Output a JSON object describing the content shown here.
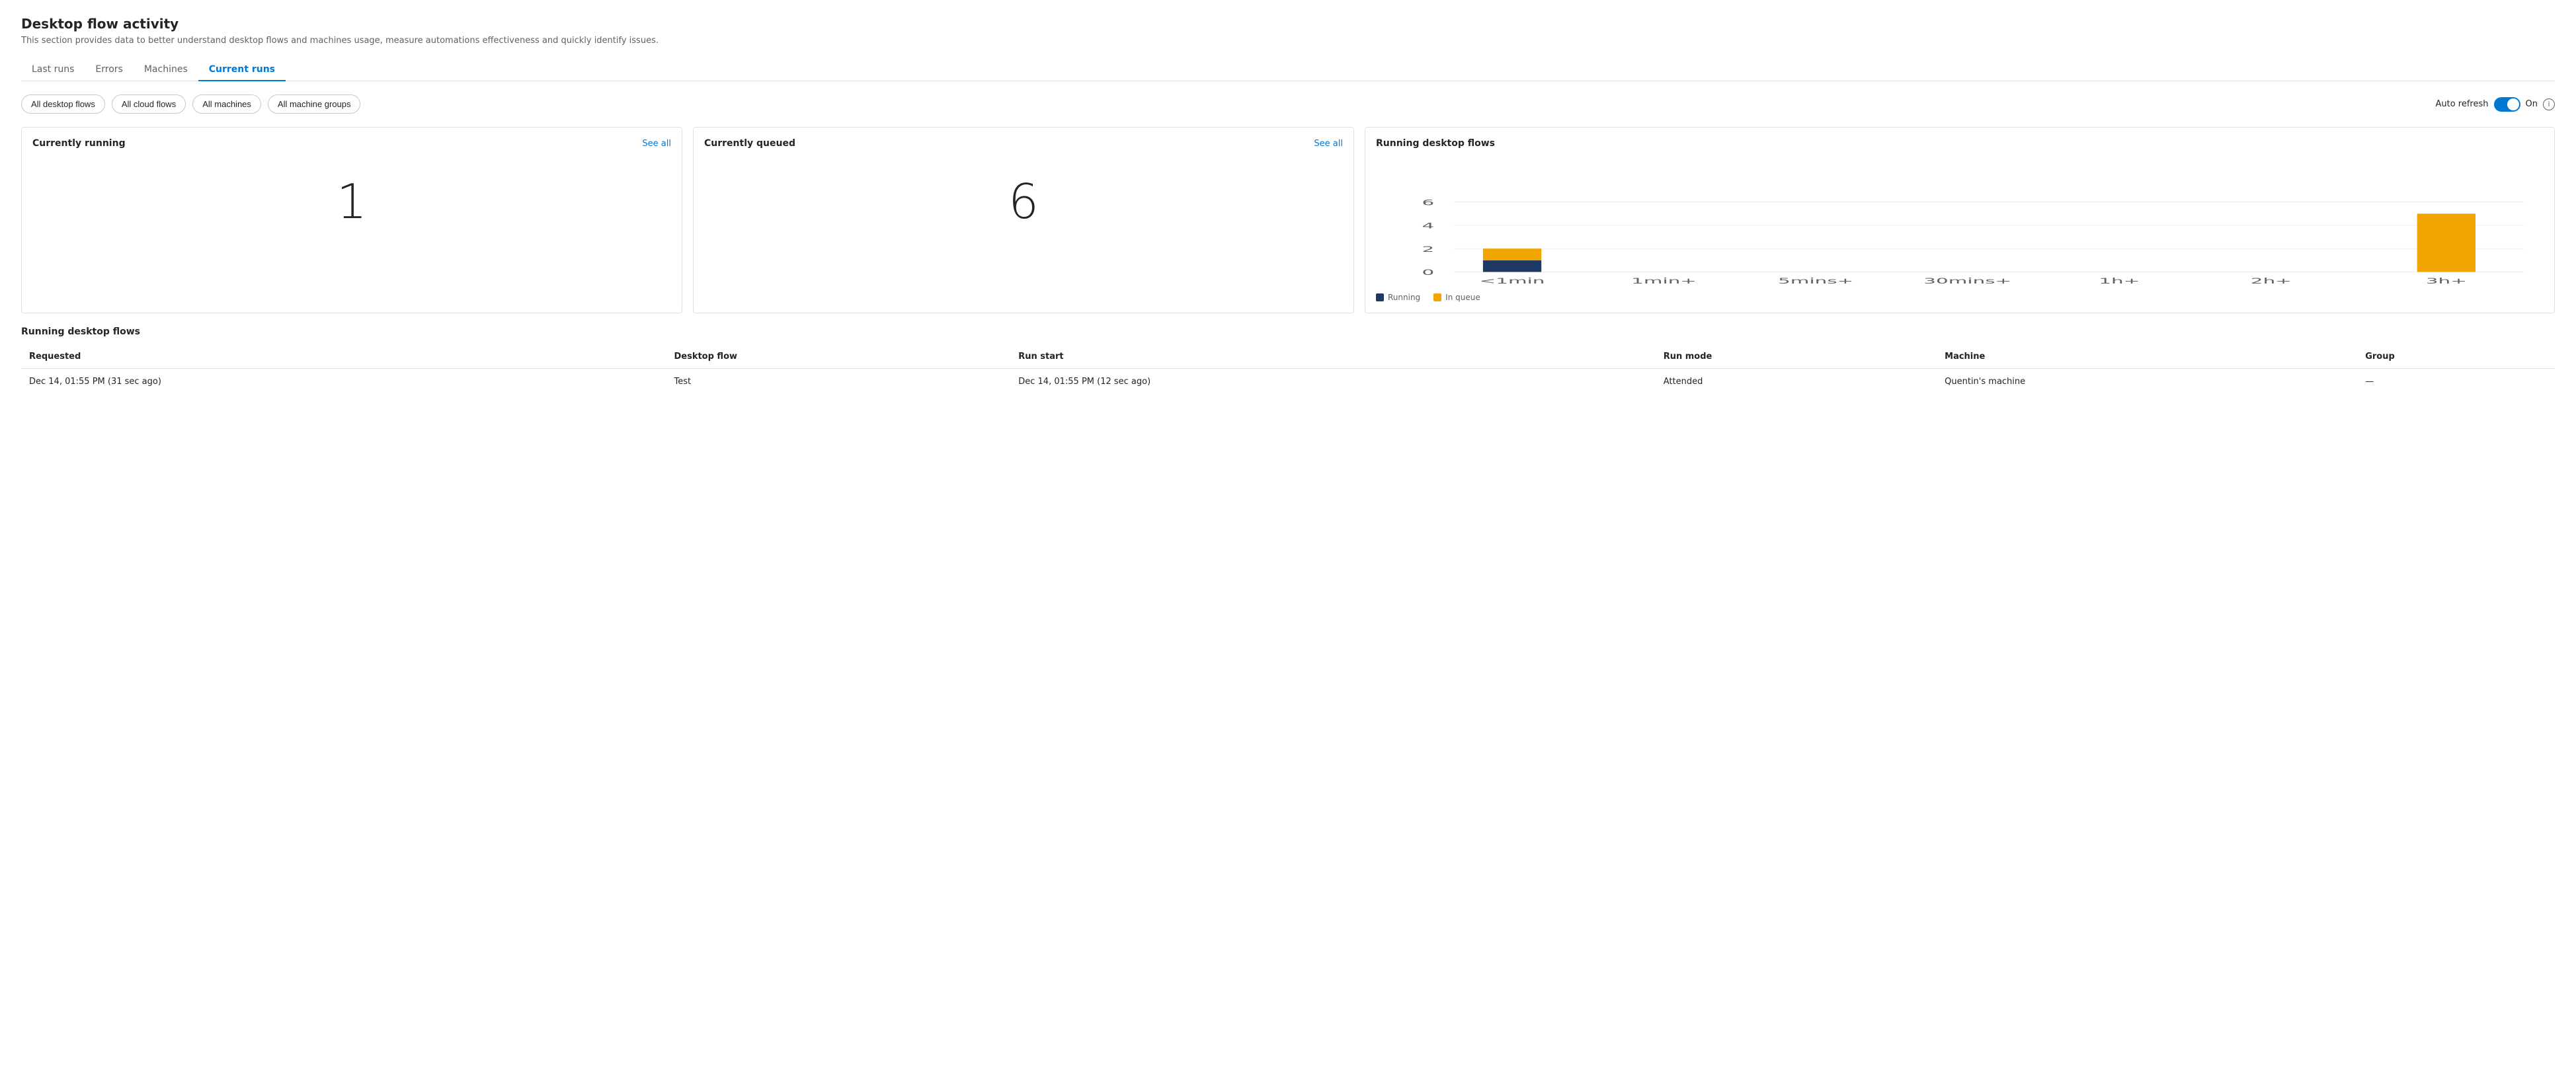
{
  "page": {
    "title": "Desktop flow activity",
    "subtitle": "This section provides data to better understand desktop flows and machines usage, measure automations effectiveness and quickly identify issues."
  },
  "tabs": [
    {
      "id": "last-runs",
      "label": "Last runs",
      "active": false
    },
    {
      "id": "errors",
      "label": "Errors",
      "active": false
    },
    {
      "id": "machines",
      "label": "Machines",
      "active": false
    },
    {
      "id": "current-runs",
      "label": "Current runs",
      "active": true
    }
  ],
  "filters": [
    {
      "id": "all-desktop-flows",
      "label": "All desktop flows"
    },
    {
      "id": "all-cloud-flows",
      "label": "All cloud flows"
    },
    {
      "id": "all-machines",
      "label": "All machines"
    },
    {
      "id": "all-machine-groups",
      "label": "All machine groups"
    }
  ],
  "auto_refresh": {
    "label": "Auto refresh",
    "state_label": "On",
    "enabled": true
  },
  "currently_running": {
    "title": "Currently running",
    "see_all_label": "See all",
    "value": "1"
  },
  "currently_queued": {
    "title": "Currently queued",
    "see_all_label": "See all",
    "value": "6"
  },
  "running_desktop_flows_chart": {
    "title": "Running desktop flows",
    "x_labels": [
      "<1min",
      "1min+",
      "5mins+",
      "30mins+",
      "1h+",
      "2h+",
      "3h+"
    ],
    "y_labels": [
      "0",
      "2",
      "4",
      "6"
    ],
    "bars": [
      {
        "label": "<1min",
        "running": 1,
        "in_queue": 1
      },
      {
        "label": "1min+",
        "running": 0,
        "in_queue": 0
      },
      {
        "label": "5mins+",
        "running": 0,
        "in_queue": 0
      },
      {
        "label": "30mins+",
        "running": 0,
        "in_queue": 0
      },
      {
        "label": "1h+",
        "running": 0,
        "in_queue": 0
      },
      {
        "label": "2h+",
        "running": 0,
        "in_queue": 0
      },
      {
        "label": "3h+",
        "running": 0,
        "in_queue": 5
      }
    ],
    "legend": [
      {
        "label": "Running",
        "color": "#1F3864"
      },
      {
        "label": "In queue",
        "color": "#F2A500"
      }
    ],
    "max_y": 6
  },
  "running_table": {
    "title": "Running desktop flows",
    "columns": [
      {
        "id": "requested",
        "label": "Requested"
      },
      {
        "id": "desktop_flow",
        "label": "Desktop flow"
      },
      {
        "id": "run_start",
        "label": "Run start"
      },
      {
        "id": "run_mode",
        "label": "Run mode"
      },
      {
        "id": "machine",
        "label": "Machine"
      },
      {
        "id": "group",
        "label": "Group"
      }
    ],
    "rows": [
      {
        "requested": "Dec 14, 01:55 PM (31 sec ago)",
        "desktop_flow": "Test",
        "run_start": "Dec 14, 01:55 PM (12 sec ago)",
        "run_mode": "Attended",
        "machine": "Quentin's machine",
        "group": "—"
      }
    ]
  }
}
